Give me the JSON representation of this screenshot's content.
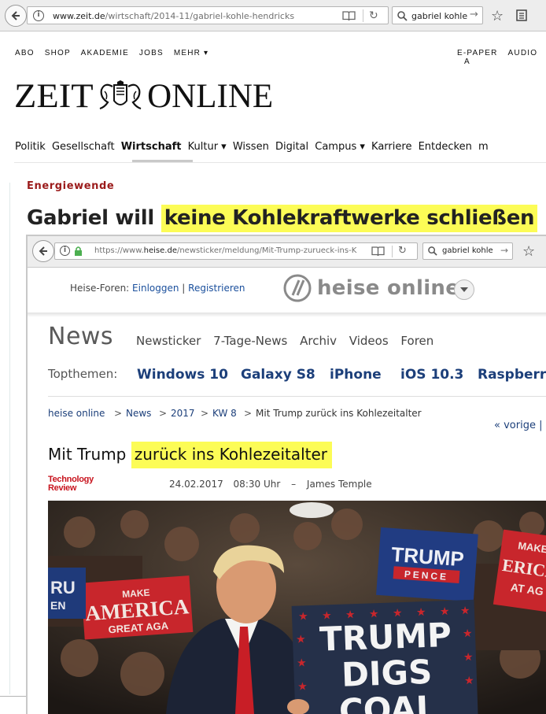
{
  "browser1": {
    "url_host": "www.zeit.de",
    "url_path": "/wirtschaft/2014-11/gabriel-kohle-hendricks",
    "search": "gabriel kohle"
  },
  "zeit": {
    "topmenu": [
      "ABO",
      "SHOP",
      "AKADEMIE",
      "JOBS",
      "MEHR ▾"
    ],
    "topmenu_right": [
      "E-PAPER",
      "AUDIO",
      "A"
    ],
    "logo_left": "ZEIT",
    "logo_right": "ONLINE",
    "nav": [
      "Politik",
      "Gesellschaft",
      "Wirtschaft",
      "Kultur ▾",
      "Wissen",
      "Digital",
      "Campus ▾",
      "Karriere",
      "Entdecken",
      "m"
    ],
    "kicker": "Energiewende",
    "headline_plain": "Gabriel will ",
    "headline_highlight": "keine Kohlekraftwerke schließen"
  },
  "browser2": {
    "url_proto": "https://www.",
    "url_host": "heise.de",
    "url_path": "/newsticker/meldung/Mit-Trump-zurueck-ins-K",
    "search": "gabriel kohle"
  },
  "heise": {
    "foren_label": "Heise-Foren: ",
    "login": "Einloggen",
    "divider": " | ",
    "register": "Registrieren",
    "brand": "heise online",
    "news": "News",
    "nav": [
      "Newsticker",
      "7-Tage-News",
      "Archiv",
      "Videos",
      "Foren"
    ],
    "topthemen_label": "Topthemen:",
    "topthemen": [
      "Windows 10",
      "Galaxy S8",
      "iPhone",
      "iOS 10.3",
      "Raspberry"
    ],
    "breadcrumb": [
      "heise online",
      "News",
      "2017",
      "KW 8",
      "Mit Trump zurück ins Kohlezeitalter"
    ],
    "breadcrumb_sep": ">",
    "prev": "« vorige |",
    "headline_plain": "Mit Trump ",
    "headline_highlight": "zurück ins Kohlezeitalter",
    "source_line1": "Technology",
    "source_line2": "Review",
    "date": "24.02.2017",
    "time": "08:30 Uhr",
    "dash": "–",
    "author": "James Temple",
    "photo": {
      "sign1_line1": "MAKE",
      "sign1_line2": "AMERICA",
      "sign1_line3": "GREAT AGA",
      "sign2_line1": "TRUMP",
      "sign2_line2": "PENCE",
      "sign3_line1": "MAKE",
      "sign3_line2": "ERICA",
      "sign3_line3": "AT AG",
      "sign4_line1": "RU",
      "sign4_line2": "EN",
      "main_line1": "TRUMP",
      "main_line2": "DIGS",
      "main_line3": "COAL"
    }
  },
  "colors": {
    "highlight": "#fcfc56",
    "zeit_kicker": "#9b1b1b",
    "heise_link": "#1c3f7a",
    "heise_foren_link": "#1a4f9c",
    "tr_red": "#c8141e"
  }
}
